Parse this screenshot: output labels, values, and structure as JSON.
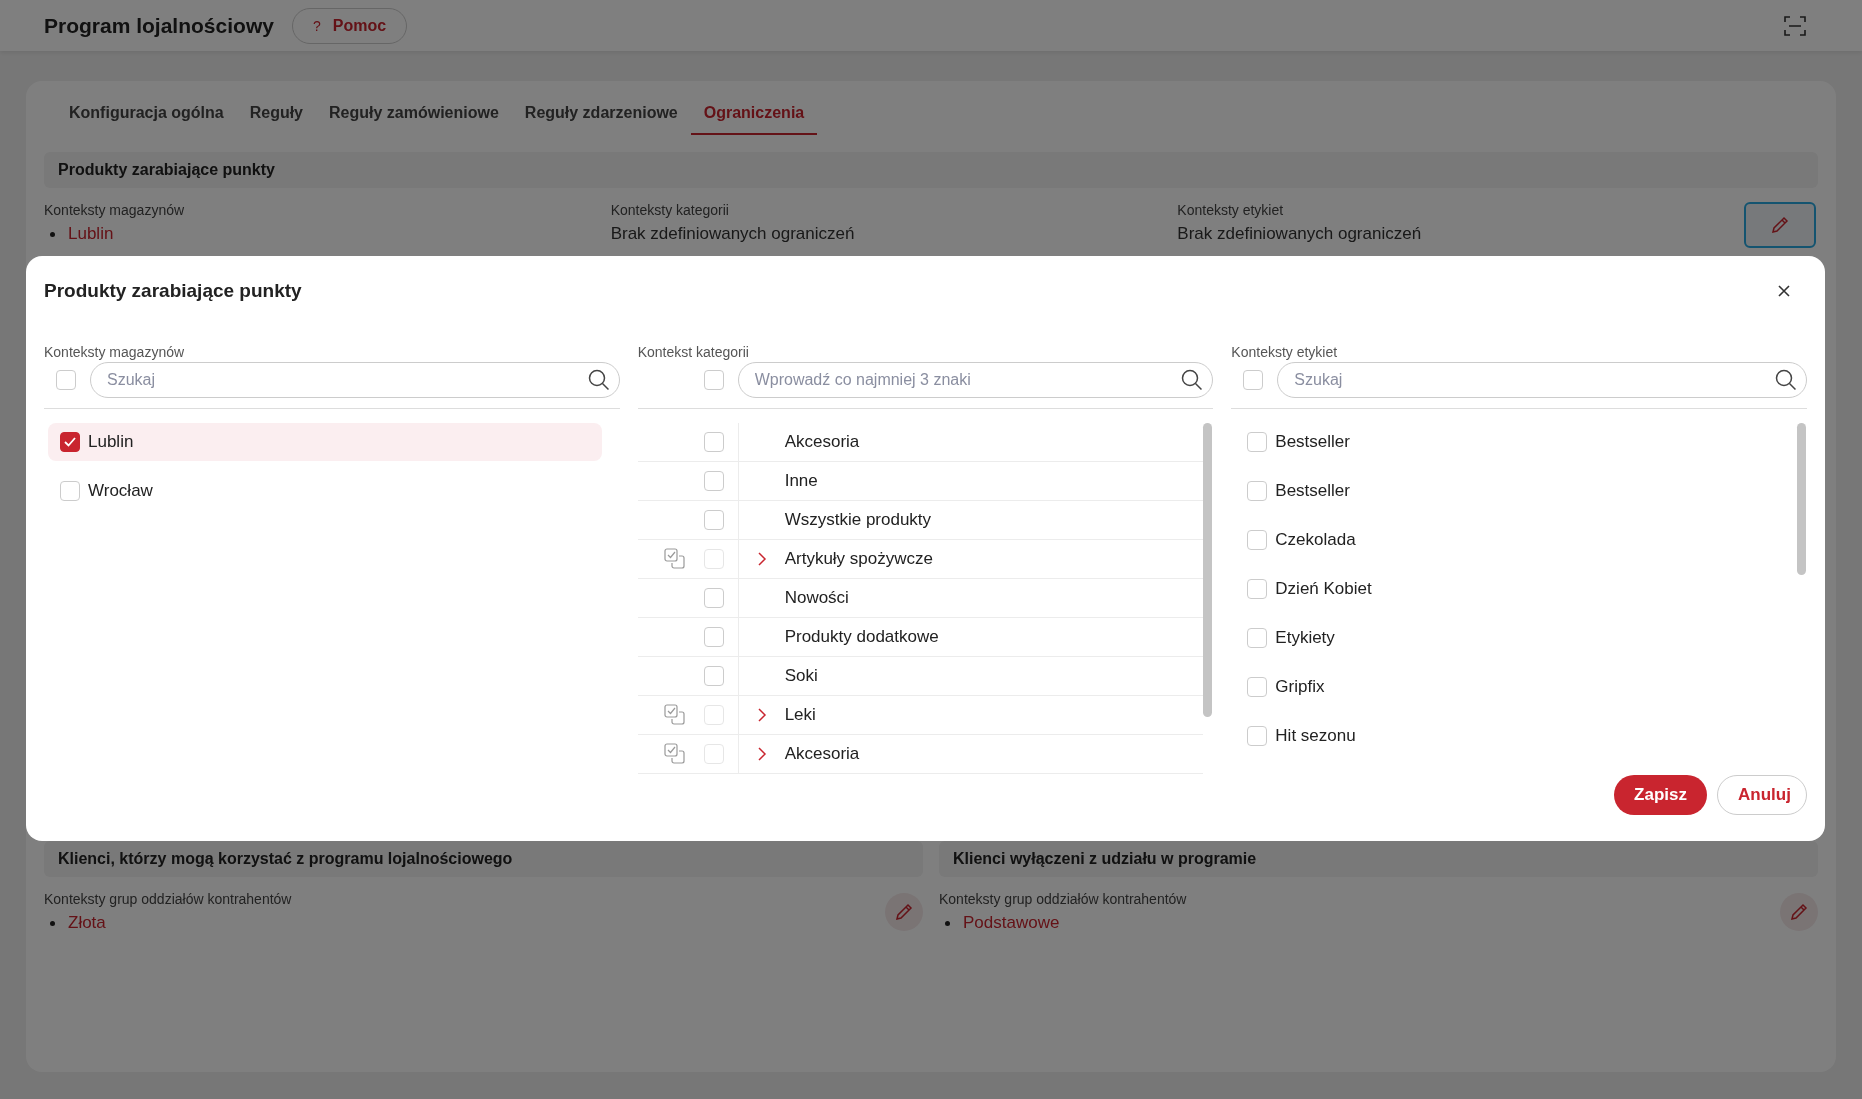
{
  "header": {
    "title": "Program lojalnościowy",
    "help_icon": "?",
    "help_button": "Pomoc"
  },
  "tabs": [
    {
      "label": "Konfiguracja ogólna",
      "selected": false
    },
    {
      "label": "Reguły",
      "selected": false
    },
    {
      "label": "Reguły zamówieniowe",
      "selected": false
    },
    {
      "label": "Reguły zdarzeniowe",
      "selected": false
    },
    {
      "label": "Ograniczenia",
      "selected": true
    }
  ],
  "section": {
    "title": "Produkty zarabiające punkty",
    "edit_focused": true,
    "fields": [
      {
        "label": "Konteksty magazynów",
        "values": [
          "Lublin"
        ]
      },
      {
        "label": "Konteksty kategorii",
        "empty_text": "Brak zdefiniowanych ograniczeń"
      },
      {
        "label": "Konteksty etykiet",
        "empty_text": "Brak zdefiniowanych ograniczeń"
      }
    ]
  },
  "lower_sections": [
    {
      "title": "Klienci, którzy mogą korzystać z programu lojalnościowego",
      "field_label": "Konteksty grup oddziałów kontrahentów",
      "values": [
        "Złota"
      ],
      "edit_focused": false
    },
    {
      "title": "Klienci wyłączeni z udziału w programie",
      "field_label": "Konteksty grup oddziałów kontrahentów",
      "values": [
        "Podstawowe"
      ],
      "edit_focused": false
    }
  ],
  "modal": {
    "title": "Produkty zarabiające punkty",
    "columns": [
      {
        "kind": "list",
        "label": "Konteksty magazynów",
        "placeholder": "Szukaj",
        "select_all_checked": false,
        "items": [
          {
            "label": "Lublin",
            "checked": true
          },
          {
            "label": "Wrocław",
            "checked": false
          }
        ]
      },
      {
        "kind": "tree",
        "label": "Kontekst kategorii",
        "placeholder": "Wprowadź co najmniej 3 znaki",
        "select_all_checked": false,
        "items": [
          {
            "kind": "leaf",
            "label": "Akcesoria",
            "checked": false
          },
          {
            "kind": "leaf",
            "label": "Inne",
            "checked": false
          },
          {
            "kind": "leaf",
            "label": "Wszystkie produkty",
            "checked": false
          },
          {
            "kind": "group",
            "label": "Artykuły spożywcze",
            "checked": false,
            "expanded": false
          },
          {
            "kind": "leaf",
            "label": "Nowości",
            "checked": false
          },
          {
            "kind": "leaf",
            "label": "Produkty dodatkowe",
            "checked": false
          },
          {
            "kind": "leaf",
            "label": "Soki",
            "checked": false
          },
          {
            "kind": "group",
            "label": "Leki",
            "checked": false,
            "expanded": false
          },
          {
            "kind": "group",
            "label": "Akcesoria",
            "checked": false,
            "expanded": false
          }
        ]
      },
      {
        "kind": "list",
        "label": "Konteksty etykiet",
        "placeholder": "Szukaj",
        "select_all_checked": false,
        "items": [
          {
            "label": "Bestseller",
            "checked": false
          },
          {
            "label": "Bestseller",
            "checked": false
          },
          {
            "label": "Czekolada",
            "checked": false
          },
          {
            "label": "Dzień Kobiet",
            "checked": false
          },
          {
            "label": "Etykiety",
            "checked": false
          },
          {
            "label": "Gripfix",
            "checked": false
          },
          {
            "label": "Hit sezonu",
            "checked": false
          }
        ]
      }
    ],
    "buttons": [
      {
        "kind": "primary",
        "label": "Zapisz"
      },
      {
        "kind": "secondary",
        "label": "Anuluj"
      }
    ]
  }
}
